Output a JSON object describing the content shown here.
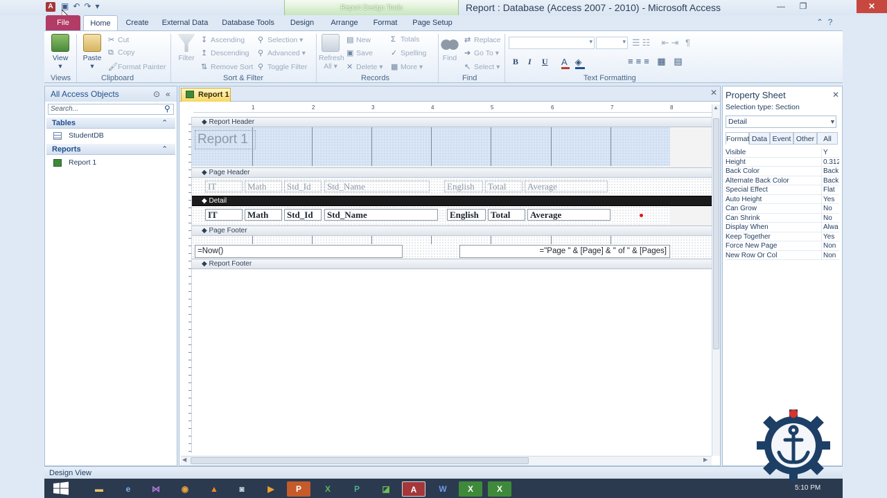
{
  "window": {
    "title": "Report : Database (Access 2007 - 2010)  -  Microsoft Access",
    "contextual_group": "Report Design Tools",
    "app_icon_letter": "A"
  },
  "ribbon": {
    "tabs": [
      "File",
      "Home",
      "Create",
      "External Data",
      "Database Tools",
      "Design",
      "Arrange",
      "Format",
      "Page Setup"
    ],
    "groups": {
      "views": {
        "label": "Views",
        "view": "View"
      },
      "clipboard": {
        "label": "Clipboard",
        "paste": "Paste",
        "cut": "Cut",
        "copy": "Copy",
        "format_painter": "Format Painter"
      },
      "sort_filter": {
        "label": "Sort & Filter",
        "filter": "Filter",
        "ascending": "Ascending",
        "descending": "Descending",
        "remove_sort": "Remove Sort",
        "selection": "Selection",
        "advanced": "Advanced",
        "toggle_filter": "Toggle Filter"
      },
      "records": {
        "label": "Records",
        "refresh": "Refresh",
        "refresh_all": "All",
        "new": "New",
        "save": "Save",
        "delete": "Delete",
        "totals": "Totals",
        "spelling": "Spelling",
        "more": "More"
      },
      "find": {
        "label": "Find",
        "find": "Find",
        "replace": "Replace",
        "goto": "Go To",
        "select": "Select"
      },
      "text_formatting": {
        "label": "Text Formatting",
        "bold": "B",
        "italic": "I",
        "underline": "U"
      }
    }
  },
  "nav": {
    "header": "All Access Objects",
    "search_placeholder": "Search...",
    "sections": [
      {
        "name": "Tables",
        "items": [
          "StudentDB"
        ]
      },
      {
        "name": "Reports",
        "items": [
          "Report 1"
        ]
      }
    ]
  },
  "document": {
    "tab": "Report 1",
    "ruler_marks": [
      "1",
      "2",
      "3",
      "4",
      "5",
      "6",
      "7",
      "8"
    ],
    "sections": {
      "report_header": "Report Header",
      "page_header": "Page Header",
      "detail": "Detail",
      "page_footer": "Page Footer",
      "report_footer": "Report Footer"
    },
    "report_title": "Report 1",
    "header_labels": [
      "IT",
      "Math",
      "Std_Id",
      "Std_Name",
      "English",
      "Total",
      "Average"
    ],
    "detail_fields": [
      "IT",
      "Math",
      "Std_Id",
      "Std_Name",
      "English",
      "Total",
      "Average"
    ],
    "footer_left": "=Now()",
    "footer_right": "=\"Page \" & [Page] & \" of \" & [Pages]"
  },
  "property_sheet": {
    "title": "Property Sheet",
    "selection_type": "Selection type:  Section",
    "selected_object": "Detail",
    "tabs": [
      "Format",
      "Data",
      "Event",
      "Other",
      "All"
    ],
    "rows": [
      {
        "name": "Visible",
        "value": "Y"
      },
      {
        "name": "Height",
        "value": "0.312"
      },
      {
        "name": "Back Color",
        "value": "Back"
      },
      {
        "name": "Alternate Back Color",
        "value": "Back"
      },
      {
        "name": "Special Effect",
        "value": "Flat"
      },
      {
        "name": "Auto Height",
        "value": "Yes"
      },
      {
        "name": "Can Grow",
        "value": "No"
      },
      {
        "name": "Can Shrink",
        "value": "No"
      },
      {
        "name": "Display When",
        "value": "Alwa"
      },
      {
        "name": "Keep Together",
        "value": "Yes"
      },
      {
        "name": "Force New Page",
        "value": "Non"
      },
      {
        "name": "New Row Or Col",
        "value": "Non"
      }
    ]
  },
  "status_bar": {
    "text": "Design View"
  },
  "taskbar": {
    "clock": "5:10 PM",
    "apps": [
      "explorer",
      "visual-studio",
      "chrome",
      "vlc",
      "app",
      "media",
      "powerpoint",
      "excel",
      "publisher",
      "project",
      "access",
      "word",
      "excel-alt",
      "excel-alt2"
    ]
  },
  "colors": {
    "file_tab": "#b13c66",
    "contextual": "#9cc48c",
    "close": "#c7483e",
    "doc_tab": "#f7d661",
    "detail_bar": "#1b1b1b"
  }
}
